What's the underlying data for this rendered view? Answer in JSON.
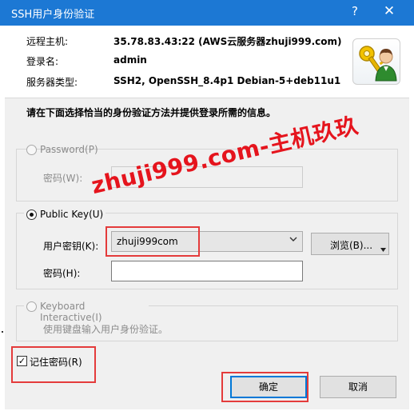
{
  "window": {
    "title": "SSH用户身份验证",
    "help_glyph": "?",
    "close_glyph": "✕"
  },
  "info": {
    "remote_host_label": "远程主机:",
    "remote_host_value": "35.78.83.43:22 (AWS云服务器zhuji999.com)",
    "login_label": "登录名:",
    "login_value": "admin",
    "server_type_label": "服务器类型:",
    "server_type_value": "SSH2, OpenSSH_8.4p1 Debian-5+deb11u1",
    "logo_icon": "key-user-icon"
  },
  "prompt": "请在下面选择恰当的身份验证方法并提供登录所需的信息。",
  "password_method": {
    "label": "Password(P)",
    "password_label": "密码(W):",
    "selected": false,
    "enabled": false
  },
  "publickey_method": {
    "label": "Public Key(U)",
    "user_key_label": "用户密钥(K):",
    "user_key_value": "zhuji999com",
    "browse_label": "浏览(B)...",
    "password_label": "密码(H):",
    "password_value": "",
    "selected": true
  },
  "keyboard_method": {
    "label": "Keyboard Interactive(I)",
    "description": "使用键盘输入用户身份验证。",
    "selected": false,
    "enabled": false
  },
  "remember_password": {
    "label": "记住密码(R)",
    "checked": true
  },
  "buttons": {
    "ok": "确定",
    "cancel": "取消"
  },
  "watermark": "zhuji999.com-主机玖玖",
  "colors": {
    "titlebar": "#1c78d4",
    "highlight_box": "#e43b3b",
    "watermark": "#e5141d",
    "focus_border": "#0078d7"
  }
}
